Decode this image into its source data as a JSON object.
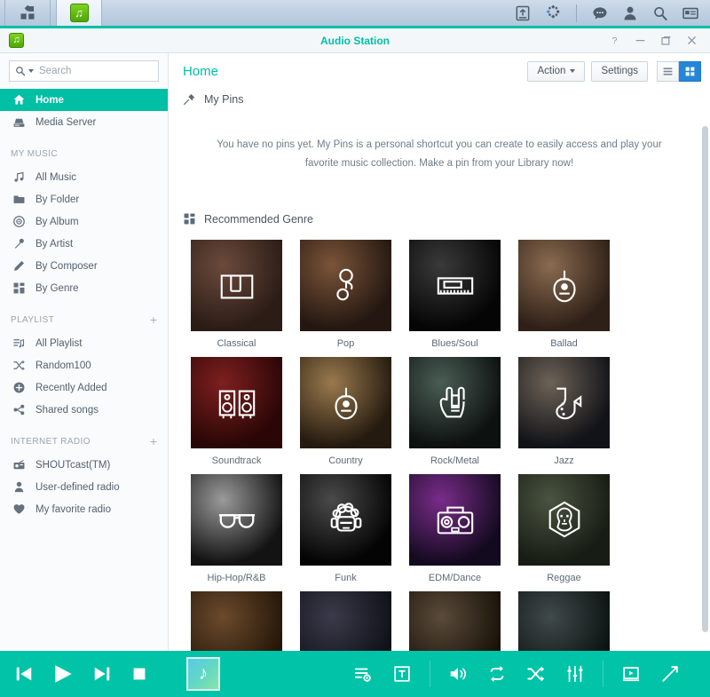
{
  "taskbar": {
    "app_tile_label": "main-menu",
    "active_app_label": "Audio Station",
    "icons": [
      "upload-icon",
      "resource-monitor-icon",
      "notifications-icon",
      "user-icon",
      "search-icon",
      "widgets-icon"
    ]
  },
  "window": {
    "title": "Audio Station",
    "controls": [
      "help-button",
      "minimize-button",
      "maximize-button",
      "close-button"
    ]
  },
  "search": {
    "value": "",
    "placeholder": "Search"
  },
  "sidebar": {
    "top_items": [
      {
        "label": "Home",
        "icon": "home-icon",
        "selected": true
      },
      {
        "label": "Media Server",
        "icon": "media-server-icon",
        "selected": false
      }
    ],
    "groups": [
      {
        "title": "MY MUSIC",
        "add": false,
        "items": [
          {
            "label": "All Music",
            "icon": "music-note-icon"
          },
          {
            "label": "By Folder",
            "icon": "folder-icon"
          },
          {
            "label": "By Album",
            "icon": "disc-icon"
          },
          {
            "label": "By Artist",
            "icon": "microphone-icon"
          },
          {
            "label": "By Composer",
            "icon": "pen-icon"
          },
          {
            "label": "By Genre",
            "icon": "grid-icon"
          }
        ]
      },
      {
        "title": "PLAYLIST",
        "add": true,
        "add_label": "+",
        "items": [
          {
            "label": "All Playlist",
            "icon": "playlist-icon"
          },
          {
            "label": "Random100",
            "icon": "shuffle-icon"
          },
          {
            "label": "Recently Added",
            "icon": "plus-circle-icon"
          },
          {
            "label": "Shared songs",
            "icon": "share-icon"
          }
        ]
      },
      {
        "title": "INTERNET RADIO",
        "add": true,
        "add_label": "+",
        "items": [
          {
            "label": "SHOUTcast(TM)",
            "icon": "radio-icon"
          },
          {
            "label": "User-defined radio",
            "icon": "person-icon"
          },
          {
            "label": "My favorite radio",
            "icon": "heart-icon"
          }
        ]
      }
    ]
  },
  "header": {
    "title": "Home",
    "action_label": "Action",
    "settings_label": "Settings",
    "view_list_label": "list-view",
    "view_grid_label": "grid-view",
    "active_view": "grid"
  },
  "pins": {
    "heading": "My Pins",
    "icon": "pin-icon",
    "empty_message": "You have no pins yet. My Pins is a personal shortcut you can create to easily access and play your favorite music collection. Make a pin from your Library now!"
  },
  "genre": {
    "heading": "Recommended Genre",
    "icon": "grid-icon",
    "tiles": [
      {
        "label": "Classical",
        "icon": "piano-icon",
        "bg1": "#6b4a3c",
        "bg2": "#2b1c16"
      },
      {
        "label": "Pop",
        "icon": "microphone-icon",
        "bg1": "#7a5438",
        "bg2": "#241711"
      },
      {
        "label": "Blues/Soul",
        "icon": "keyboard-icon",
        "bg1": "#3a3a3a",
        "bg2": "#050505"
      },
      {
        "label": "Ballad",
        "icon": "guitar-icon",
        "bg1": "#8a6b50",
        "bg2": "#2f2017"
      },
      {
        "label": "Soundtrack",
        "icon": "speakers-icon",
        "bg1": "#7e1f1f",
        "bg2": "#2a0606"
      },
      {
        "label": "Country",
        "icon": "guitar-icon",
        "bg1": "#9a7a4e",
        "bg2": "#241a0f"
      },
      {
        "label": "Rock/Metal",
        "icon": "rockhand-icon",
        "bg1": "#4a5d55",
        "bg2": "#0d1110"
      },
      {
        "label": "Jazz",
        "icon": "saxophone-icon",
        "bg1": "#6d6256",
        "bg2": "#121318"
      },
      {
        "label": "Hip-Hop/R&B",
        "icon": "sunglasses-icon",
        "bg1": "#9a9a9a",
        "bg2": "#131313"
      },
      {
        "label": "Funk",
        "icon": "afro-icon",
        "bg1": "#4a4a4a",
        "bg2": "#040404"
      },
      {
        "label": "EDM/Dance",
        "icon": "boombox-icon",
        "bg1": "#7a2c8a",
        "bg2": "#140a20"
      },
      {
        "label": "Reggae",
        "icon": "lion-icon",
        "bg1": "#4a5340",
        "bg2": "#171c14"
      },
      {
        "label": "",
        "icon": "",
        "bg1": "#6b4a2c",
        "bg2": "#241608"
      },
      {
        "label": "",
        "icon": "",
        "bg1": "#3a3a4a",
        "bg2": "#101018"
      },
      {
        "label": "",
        "icon": "",
        "bg1": "#5a4a3a",
        "bg2": "#181208"
      },
      {
        "label": "",
        "icon": "",
        "bg1": "#404a4a",
        "bg2": "#0c1212"
      }
    ]
  },
  "player": {
    "prev_label": "previous-track",
    "play_label": "play",
    "next_label": "next-track",
    "stop_label": "stop",
    "album_art_label": "album-art",
    "right_icons": [
      "playlist-icon",
      "lyrics-icon",
      "volume-icon",
      "repeat-icon",
      "shuffle-icon",
      "equalizer-icon",
      "mini-player-icon",
      "collapse-icon"
    ]
  },
  "colors": {
    "teal": "#00bfa5",
    "player_teal": "#00c3a8",
    "accent_blue": "#2486d8",
    "taskbar": "#bfd0e2"
  }
}
